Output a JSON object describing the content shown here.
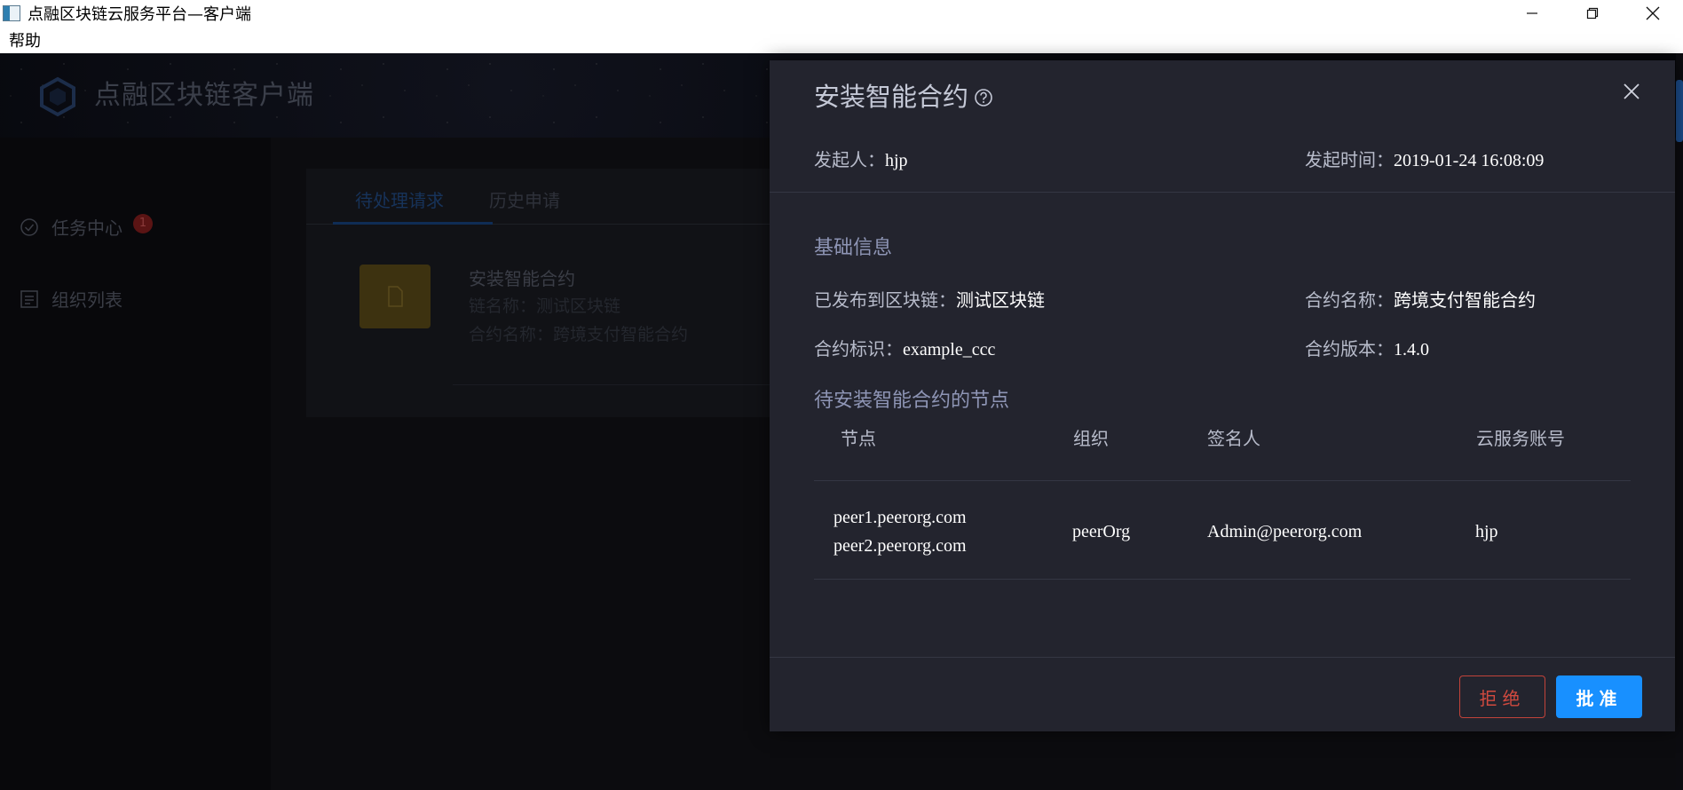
{
  "window": {
    "title": "点融区块链云服务平台—客户端",
    "menu": [
      "帮助"
    ]
  },
  "app": {
    "name": "点融区块链客户端",
    "sidebar": [
      {
        "label": "任务中心",
        "badge": "1"
      },
      {
        "label": "组织列表"
      }
    ],
    "tabs": [
      "待处理请求",
      "历史申请"
    ],
    "request": {
      "title": "安装智能合约",
      "chain_line": "链名称：测试区块链",
      "contract_line": "合约名称：跨境支付智能合约"
    }
  },
  "modal": {
    "title": "安装智能合约",
    "initiator_label": "发起人：",
    "initiator": "hjp",
    "time_label": "发起时间：",
    "time": "2019-01-24 16:08:09",
    "basic_title": "基础信息",
    "chain_label": "已发布到区块链：",
    "chain": "测试区块链",
    "contract_name_label": "合约名称：",
    "contract_name": "跨境支付智能合约",
    "contract_id_label": "合约标识：",
    "contract_id": "example_ccc",
    "version_label": "合约版本：",
    "version": "1.4.0",
    "nodes_title": "待安装智能合约的节点",
    "table": {
      "headers": [
        "节点",
        "组织",
        "签名人",
        "云服务账号"
      ],
      "rows": [
        {
          "nodes": [
            "peer1.peerorg.com",
            "peer2.peerorg.com"
          ],
          "org": "peerOrg",
          "signer": "Admin@peerorg.com",
          "account": "hjp"
        }
      ]
    },
    "reject_label": "拒绝",
    "approve_label": "批准"
  }
}
